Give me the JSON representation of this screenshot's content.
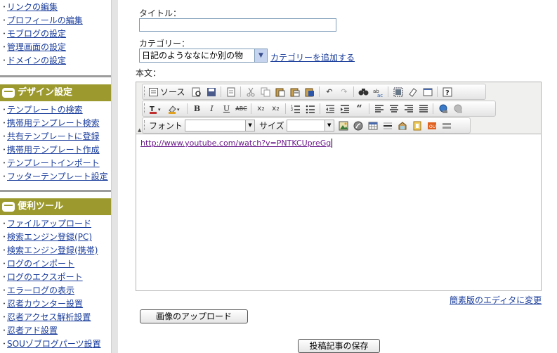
{
  "sidebar": {
    "group1": [
      "リンクの編集",
      "プロフィールの編集",
      "モブログの設定",
      "管理画面の設定",
      "ドメインの設定"
    ],
    "design_header": "デザイン設定",
    "design_items": [
      "テンプレートの検索",
      "携帯用テンプレート検索",
      "共有テンプレートに登録",
      "携帯用テンプレート作成",
      "テンプレートインポート",
      "フッターテンプレート設定"
    ],
    "tools_header": "便利ツール",
    "tools_items": [
      "ファイルアップロード",
      "検索エンジン登録(PC)",
      "検索エンジン登録(携帯)",
      "ログのインポート",
      "ログのエクスポート",
      "エラーログの表示",
      "忍者カウンター設置",
      "忍者アクセス解析設置",
      "忍者アド設置",
      "SOUゾブログパーツ設置"
    ]
  },
  "form": {
    "title_label": "タイトル：",
    "title_value": "",
    "category_label": "カテゴリー：",
    "category_value": "日記のようななにか別の物",
    "category_add": "カテゴリーを追加する",
    "body_label": "本文："
  },
  "toolbar": {
    "source_label": "ソース",
    "font_label": "フォント",
    "size_label": "サイズ"
  },
  "editor": {
    "content": "http://www.youtube.com/watch?v=PNTKCUpreGg"
  },
  "footer": {
    "simple_editor": "簡素版のエディタに変更",
    "upload_button": "画像のアップロード",
    "save_button": "投稿記事の保存"
  }
}
